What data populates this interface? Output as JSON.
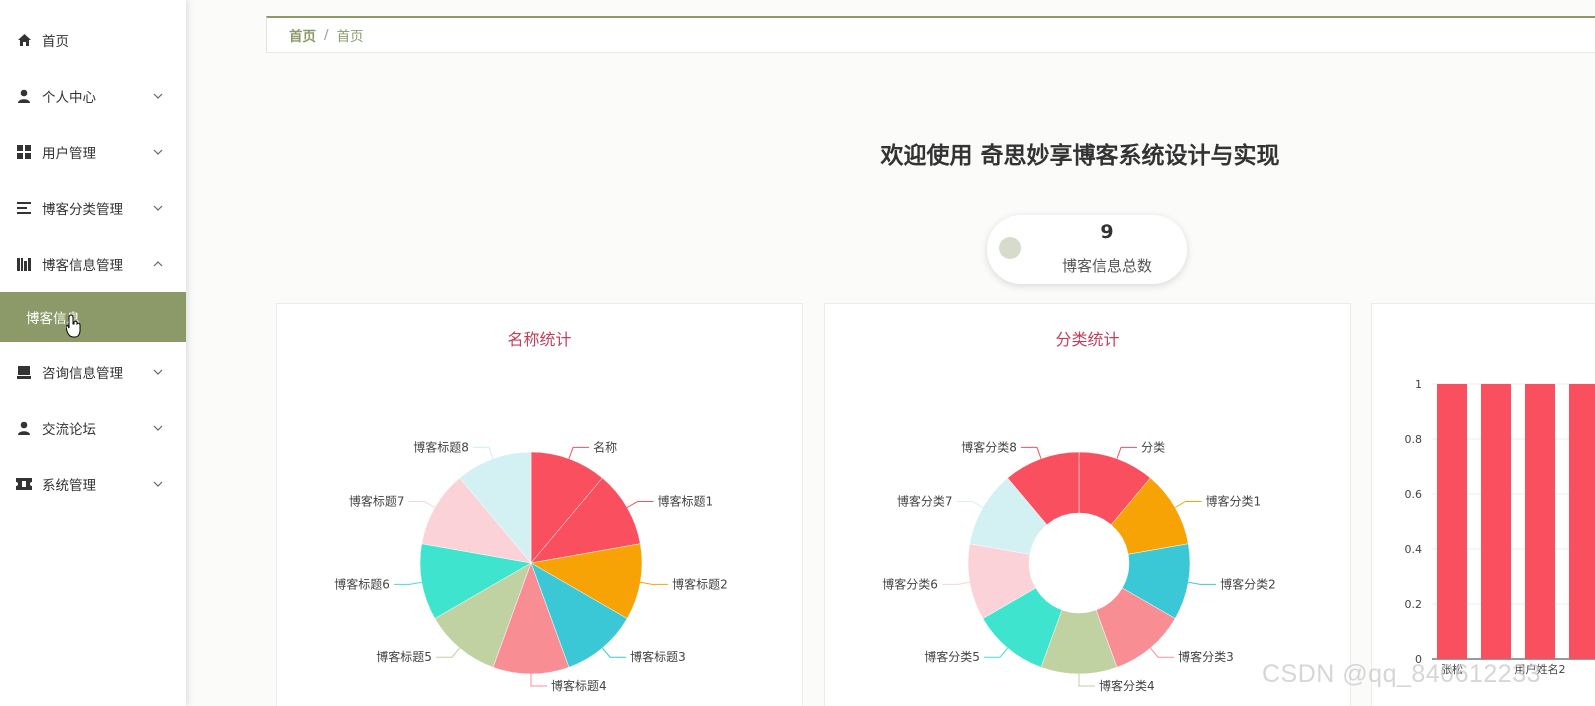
{
  "sidebar": {
    "items": [
      {
        "label": "首页",
        "icon": "home-icon",
        "has_chevron": false
      },
      {
        "label": "个人中心",
        "icon": "user-icon",
        "has_chevron": true
      },
      {
        "label": "用户管理",
        "icon": "grid-icon",
        "has_chevron": true
      },
      {
        "label": "博客分类管理",
        "icon": "list-icon",
        "has_chevron": true
      },
      {
        "label": "博客信息管理",
        "icon": "book-icon",
        "has_chevron": true,
        "expanded": true
      },
      {
        "label": "咨询信息管理",
        "icon": "inbox-icon",
        "has_chevron": true
      },
      {
        "label": "交流论坛",
        "icon": "user-icon",
        "has_chevron": true
      },
      {
        "label": "系统管理",
        "icon": "ticket-icon",
        "has_chevron": true
      }
    ],
    "active_sub": "博客信息"
  },
  "breadcrumb": {
    "home": "首页",
    "separator": "/",
    "current": "首页"
  },
  "welcome": "欢迎使用 奇思妙享博客系统设计与实现",
  "stat": {
    "value": "9",
    "caption": "博客信息总数"
  },
  "colors": {
    "accent": "#8c9a6a",
    "title": "#c3405a"
  },
  "chart_data": [
    {
      "type": "pie",
      "title": "名称统计",
      "categories": [
        "名称",
        "博客标题1",
        "博客标题2",
        "博客标题3",
        "博客标题4",
        "博客标题5",
        "博客标题6",
        "博客标题7",
        "博客标题8"
      ],
      "values": [
        1,
        1,
        1,
        1,
        1,
        1,
        1,
        1,
        1
      ],
      "colors": [
        "#f94f5e",
        "#f94f5e",
        "#f7a205",
        "#3bc8d6",
        "#f98d94",
        "#c0d1a2",
        "#3fe4ce",
        "#fbd2d8",
        "#d3f0f3"
      ]
    },
    {
      "type": "pie",
      "title": "分类统计",
      "donut": true,
      "categories": [
        "分类",
        "博客分类1",
        "博客分类2",
        "博客分类3",
        "博客分类4",
        "博客分类5",
        "博客分类6",
        "博客分类7",
        "博客分类8"
      ],
      "values": [
        1,
        1,
        1,
        1,
        1,
        1,
        1,
        1,
        1
      ],
      "colors": [
        "#f94f5e",
        "#f7a205",
        "#3bc8d6",
        "#f98d94",
        "#c0d1a2",
        "#3fe4ce",
        "#fbd2d8",
        "#d3f0f3",
        "#f94f5e"
      ]
    },
    {
      "type": "bar",
      "categories": [
        "张松",
        "",
        "用户姓名2",
        ""
      ],
      "values": [
        1,
        1,
        1,
        1
      ],
      "ylim": [
        0,
        1
      ],
      "yticks": [
        "0",
        "0.2",
        "0.4",
        "0.6",
        "0.8",
        "1"
      ],
      "color": "#f94f5e"
    }
  ],
  "watermark": "CSDN @qq_840612233"
}
